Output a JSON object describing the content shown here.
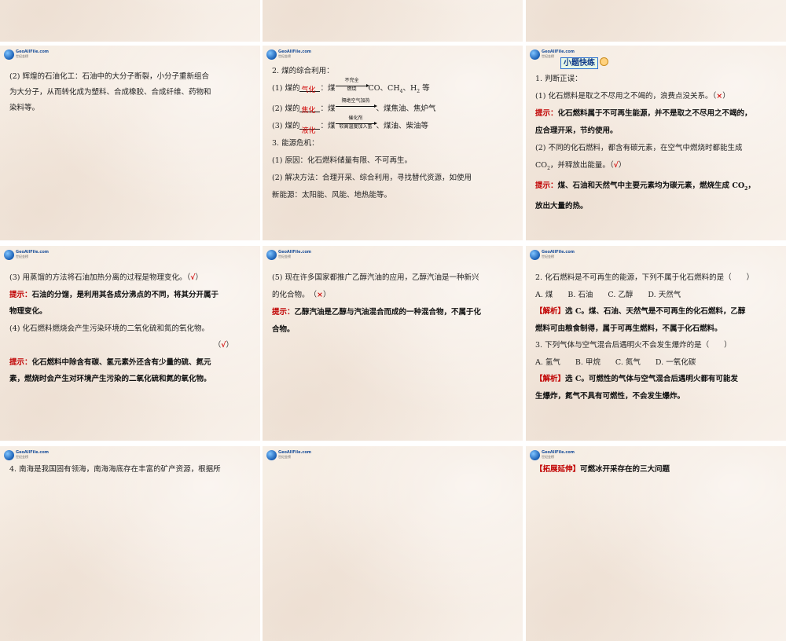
{
  "logo": {
    "text": "GeoAllFile.com",
    "subtext": "世纪金榜"
  },
  "slide2": {
    "lines": [
      "(2) 辉煌的石油化工：石油中的大分子断裂，小分子重新组合",
      "为大分子，从而转化成为塑料、合成橡胶、合成纤维、药物和",
      "染料等。"
    ]
  },
  "slide3": {
    "title": "2. 煤的综合利用：",
    "item1": {
      "prefix": "(1) 煤的",
      "answer": "气化",
      "mid": "：煤",
      "cond_top": "不完全",
      "cond_bottom": "燃烧",
      "suffix": "CO、CH",
      "sub1": "4",
      "suffix2": "、H",
      "sub2": "2",
      "suffix3": " 等"
    },
    "item2": {
      "prefix": "(2) 煤的",
      "answer": "焦化",
      "mid": "：煤",
      "cond_top": "隔绝空气加热",
      "cond_bottom": "",
      "suffix": "煤焦油、焦炉气"
    },
    "item3": {
      "prefix": "(3) 煤的",
      "answer": "液化",
      "mid": "：煤",
      "cond_top": "催化剂",
      "cond_bottom": "较高温度加入氢",
      "suffix": "煤油、柴油等"
    },
    "crisis_title": "3. 能源危机：",
    "crisis1": "(1) 原因：化石燃料储量有限、不可再生。",
    "crisis2a": "(2) 解决方法：合理开采、综合利用，寻找替代资源，如使用",
    "crisis2b": "新能源：太阳能、风能、地热能等。"
  },
  "slide4": {
    "tag": "小题快练",
    "q_title": "1. 判断正误：",
    "q1": "(1) 化石燃料是取之不尽用之不竭的，浪费点没关系。（",
    "q1_mark": "×",
    "q1_end": "）",
    "hint_label": "提示：",
    "q1_hint_a": "化石燃料属于不可再生能源，并不是取之不尽用之不竭的，",
    "q1_hint_b": "应合理开采，节约使用。",
    "q2a": "(2) 不同的化石燃料，都含有碳元素，在空气中燃烧时都能生成",
    "q2b": "CO",
    "q2b_sub": "2",
    "q2b_rest": "，并释放出能量。（",
    "q2_mark": "√",
    "q2_end": "）",
    "q2_hint_a": "煤、石油和天然气中主要元素均为碳元素，燃烧生成 CO",
    "q2_hint_sub": "2",
    "q2_hint_a_end": "，",
    "q2_hint_b": "放出大量的热。"
  },
  "slide5": {
    "q3": "(3) 用蒸馏的方法将石油加热分离的过程是物理变化。（",
    "q3_mark": "√",
    "q3_end": "）",
    "hint_label": "提示：",
    "q3_hint_a": "石油的分馏，是利用其各成分沸点的不同，将其分开属于",
    "q3_hint_b": "物理变化。",
    "q4": "(4) 化石燃料燃烧会产生污染环境的二氧化硫和氮的氧化物。",
    "q4_open": "（",
    "q4_mark": "√",
    "q4_end": "）",
    "q4_hint_a": "化石燃料中除含有碳、氢元素外还含有少量的硫、氮元",
    "q4_hint_b": "素，燃烧时会产生对环境产生污染的二氧化硫和氮的氧化物。"
  },
  "slide6": {
    "q5a": "(5) 现在许多国家都推广乙醇汽油的应用，乙醇汽油是一种新兴",
    "q5b": "的化合物。　（",
    "q5_mark": "×",
    "q5_end": "）",
    "hint_label": "提示：",
    "q5_hint_a": "乙醇汽油是乙醇与汽油混合而成的一种混合物，不属于化",
    "q5_hint_b": "合物。"
  },
  "slide7": {
    "q2": "2. 化石燃料是不可再生的能源，下列不属于化石燃料的是（　　）",
    "q2_opts": "A. 煤　　B. 石油　　C. 乙醇　　D. 天然气",
    "analysis_label": "【解析】",
    "q2_ana_a": "选 C。煤、石油、天然气是不可再生的化石燃料，乙醇",
    "q2_ana_b": "燃料可由粮食制得，属于可再生燃料，不属于化石燃料。",
    "q3": "3. 下列气体与空气混合后遇明火不会发生爆炸的是（　　）",
    "q3_opts": "A. 氢气　　B. 甲烷　　C. 氮气　　D. 一氧化碳",
    "q3_ana_a": "选 C。可燃性的气体与空气混合后遇明火都有可能发",
    "q3_ana_b": "生爆炸，氮气不具有可燃性，不会发生爆炸。"
  },
  "slide8": {
    "line": "4. 南海是我国固有领海，南海海底存在丰富的矿产资源，根据所"
  },
  "slide10": {
    "label": "【拓展延伸】",
    "text": "可燃冰开采存在的三大问题"
  }
}
